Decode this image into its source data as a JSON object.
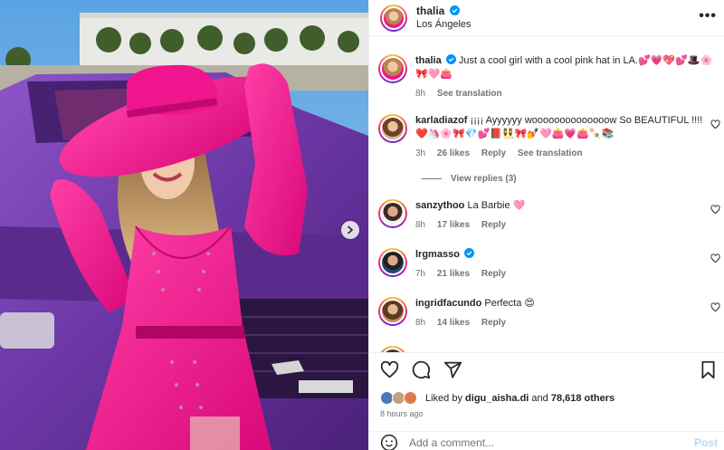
{
  "post": {
    "author": "thalia",
    "location": "Los Ángeles"
  },
  "caption": {
    "username": "thalia",
    "text": "Just a cool girl with a cool pink hat in LA.💕💗💖💕🎩🌸🎀🩷👛",
    "time": "8h",
    "translate": "See translation"
  },
  "comments": [
    {
      "username": "karladiazof",
      "text": "¡¡¡¡ Ayyyyyy woooooooooooooow So BEAUTIFUL !!!! ❤️🦄🌸🎀💎💕📕👯🎀💅🩷👛💗👛🍡📚",
      "time": "3h",
      "likes": "26 likes",
      "reply": "Reply",
      "translate": "See translation",
      "view_replies": "View replies (3)"
    },
    {
      "username": "sanzythoo",
      "text": "La Barbie 🩷",
      "time": "8h",
      "likes": "17 likes",
      "reply": "Reply"
    },
    {
      "username": "lrgmasso",
      "text": "",
      "time": "7h",
      "likes": "21 likes",
      "reply": "Reply"
    },
    {
      "username": "ingridfacundo",
      "text": "Perfecta 😍",
      "time": "8h",
      "likes": "14 likes",
      "reply": "Reply"
    }
  ],
  "footer": {
    "liked_prefix": "Liked by",
    "liked_user": "digu_aisha.di",
    "liked_and": "and",
    "liked_others": "78,618 others",
    "time_ago": "8 hours ago",
    "add_comment_placeholder": "Add a comment...",
    "post_button": "Post"
  },
  "colors": {
    "verified": "#0095f6",
    "hat_pink": "#f2128b",
    "car_purple": "#6d3aa6",
    "muted": "#737373",
    "post_disabled": "#b3dbff"
  },
  "icons": [
    "verified-icon",
    "more-options-icon",
    "heart-icon",
    "comment-icon",
    "share-icon",
    "bookmark-icon",
    "emoji-icon",
    "next-arrow-icon"
  ]
}
